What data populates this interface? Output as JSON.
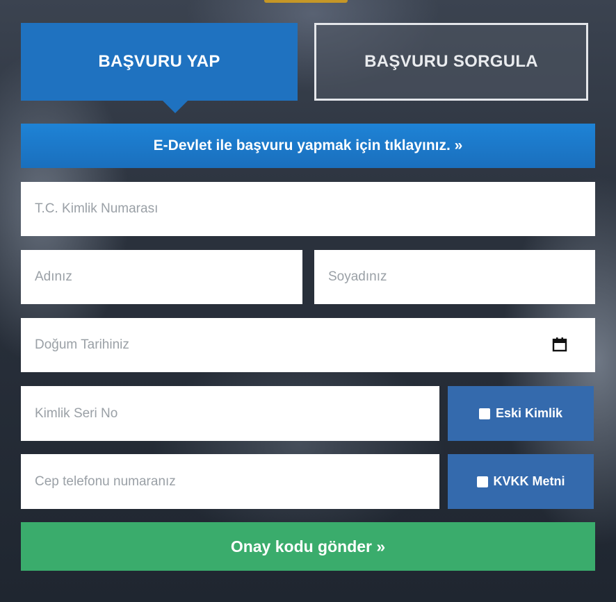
{
  "tabs": {
    "apply_label": "BAŞVURU YAP",
    "query_label": "BAŞVURU SORGULA"
  },
  "edevlet": {
    "label": "E-Devlet ile başvuru yapmak için tıklayınız. »"
  },
  "form": {
    "tc_placeholder": "T.C. Kimlik Numarası",
    "first_name_placeholder": "Adınız",
    "last_name_placeholder": "Soyadınız",
    "birth_date_placeholder": "Doğum Tarihiniz",
    "id_serial_placeholder": "Kimlik Seri No",
    "phone_placeholder": "Cep telefonu numaranız",
    "old_id_label": "Eski Kimlik",
    "kvkk_label": "KVKK Metni",
    "submit_label": "Onay kodu gönder »"
  },
  "icons": {
    "calendar": "calendar-icon",
    "checkbox": "checkbox-icon"
  },
  "colors": {
    "primary_blue": "#1f72c0",
    "side_button_blue": "#346aad",
    "submit_green": "#3aac6c"
  }
}
